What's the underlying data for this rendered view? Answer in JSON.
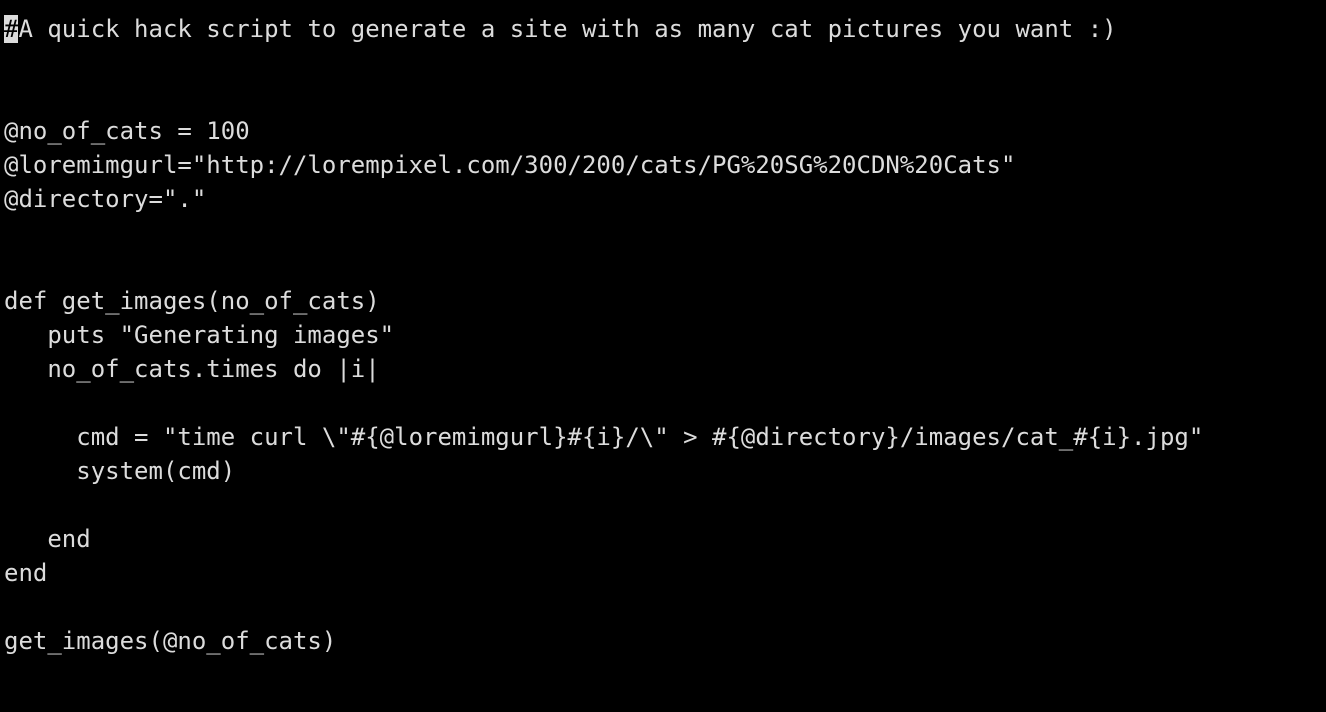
{
  "editor": {
    "cursor_char": "#",
    "lines": [
      "A quick hack script to generate a site with as many cat pictures you want :)",
      "",
      "",
      "@no_of_cats = 100",
      "@loremimgurl=\"http://lorempixel.com/300/200/cats/PG%20SG%20CDN%20Cats\"",
      "@directory=\".\"",
      "",
      "",
      "def get_images(no_of_cats)",
      "   puts \"Generating images\"",
      "   no_of_cats.times do |i|",
      "",
      "     cmd = \"time curl \\\"#{@loremimgurl}#{i}/\\\" > #{@directory}/images/cat_#{i}.jpg\"",
      "     system(cmd)",
      "",
      "   end",
      "end",
      "",
      "get_images(@no_of_cats)"
    ]
  }
}
